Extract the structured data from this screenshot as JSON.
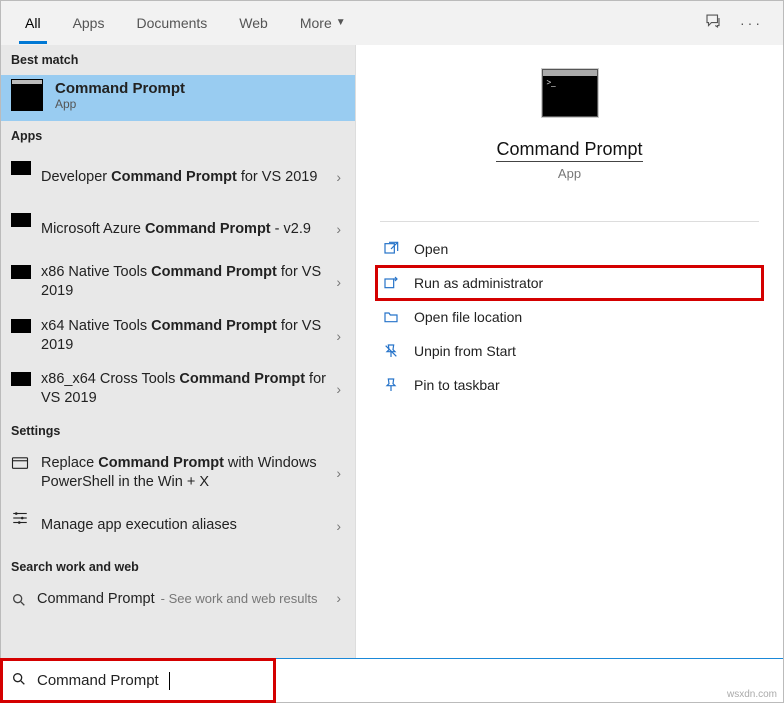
{
  "tabs": [
    "All",
    "Apps",
    "Documents",
    "Web",
    "More"
  ],
  "active_tab": 0,
  "sections": {
    "best_match": {
      "header": "Best match",
      "title": "Command Prompt",
      "subtitle": "App"
    },
    "apps": {
      "header": "Apps",
      "items": [
        {
          "pre": "Developer ",
          "bold": "Command Prompt",
          "post": " for VS 2019"
        },
        {
          "pre": "Microsoft Azure ",
          "bold": "Command Prompt",
          "post": " - v2.9"
        },
        {
          "pre": "x86 Native Tools ",
          "bold": "Command Prompt",
          "post": " for VS 2019"
        },
        {
          "pre": "x64 Native Tools ",
          "bold": "Command Prompt",
          "post": " for VS 2019"
        },
        {
          "pre": "x86_x64 Cross Tools ",
          "bold": "Command Prompt",
          "post": " for VS 2019"
        }
      ]
    },
    "settings": {
      "header": "Settings",
      "items": [
        {
          "pre": "Replace ",
          "bold": "Command Prompt",
          "post": " with Windows PowerShell in the Win + X"
        },
        {
          "pre": "",
          "bold": "",
          "post": "Manage app execution aliases"
        }
      ]
    },
    "web": {
      "header": "Search work and web",
      "label": "Command Prompt",
      "hint": "- See work and web results"
    }
  },
  "right": {
    "title": "Command Prompt",
    "subtitle": "App",
    "actions": [
      {
        "icon": "open",
        "label": "Open",
        "highlight": false
      },
      {
        "icon": "admin",
        "label": "Run as administrator",
        "highlight": true
      },
      {
        "icon": "folder",
        "label": "Open file location",
        "highlight": false
      },
      {
        "icon": "unpin",
        "label": "Unpin from Start",
        "highlight": false
      },
      {
        "icon": "pin",
        "label": "Pin to taskbar",
        "highlight": false
      }
    ]
  },
  "search": {
    "value": "Command Prompt"
  },
  "watermark": "wsxdn.com"
}
